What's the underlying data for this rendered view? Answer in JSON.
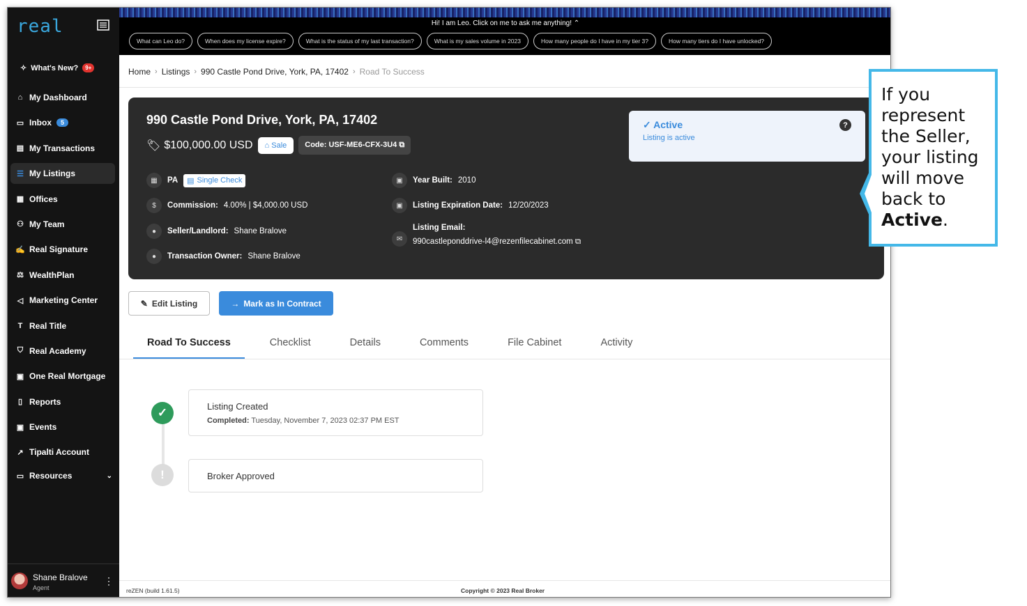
{
  "sidebar": {
    "logo": "real",
    "whats_new": "What's New?",
    "whats_new_badge": "9+",
    "items": [
      {
        "label": "My Dashboard"
      },
      {
        "label": "Inbox",
        "count": "5"
      },
      {
        "label": "My Transactions"
      },
      {
        "label": "My Listings"
      },
      {
        "label": "Offices"
      },
      {
        "label": "My Team"
      },
      {
        "label": "Real Signature"
      },
      {
        "label": "WealthPlan"
      },
      {
        "label": "Marketing Center"
      },
      {
        "label": "Real Title"
      },
      {
        "label": "Real Academy"
      },
      {
        "label": "One Real Mortgage"
      },
      {
        "label": "Reports"
      },
      {
        "label": "Events"
      },
      {
        "label": "Tipalti Account"
      },
      {
        "label": "Resources"
      }
    ],
    "user": {
      "name": "Shane Bralove",
      "role": "Agent"
    }
  },
  "banner": {
    "title": "Hi! I am Leo. Click on me to ask me anything!",
    "chips": [
      "What can Leo do?",
      "When does my license expire?",
      "What is the status of my last transaction?",
      "What is my sales volume in 2023",
      "How many people do I have in my tier 3?",
      "How many tiers do I have unlocked?"
    ]
  },
  "breadcrumb": [
    "Home",
    "Listings",
    "990 Castle Pond Drive, York, PA, 17402",
    "Road To Success"
  ],
  "listing": {
    "address": "990 Castle Pond Drive, York, PA, 17402",
    "price": "$100,000.00 USD",
    "sale_label": "Sale",
    "code": "Code: USF-ME6-CFX-3U4",
    "state": "PA",
    "single_check": "Single Check",
    "commission_label": "Commission:",
    "commission_value": "4.00% | $4,000.00 USD",
    "seller_label": "Seller/Landlord:",
    "seller_value": "Shane Bralove",
    "owner_label": "Transaction Owner:",
    "owner_value": "Shane Bralove",
    "year_label": "Year Built:",
    "year_value": "2010",
    "expiration_label": "Listing Expiration Date:",
    "expiration_value": "12/20/2023",
    "email_label": "Listing Email:",
    "email_value": "990castleponddrive-l4@rezenfilecabinet.com"
  },
  "status": {
    "title": "Active",
    "subtitle": "Listing is active"
  },
  "actions": {
    "edit": "Edit Listing",
    "contract": "Mark as In Contract"
  },
  "tabs": [
    "Road To Success",
    "Checklist",
    "Details",
    "Comments",
    "File Cabinet",
    "Activity"
  ],
  "steps": [
    {
      "title": "Listing Created",
      "sub_label": "Completed:",
      "sub_value": "Tuesday, November 7, 2023 02:37 PM EST"
    },
    {
      "title": "Broker Approved"
    }
  ],
  "footer": {
    "build": "reZEN (build 1.61.5)",
    "copyright": "Copyright © 2023 Real Broker"
  },
  "callout": {
    "text": "If you represent the Seller, your listing will move back to",
    "emphasis": "Active",
    "end": "."
  },
  "colors": {
    "accent": "#3a8bdc",
    "success": "#2e9b5b",
    "callout_border": "#44b8e8",
    "card": "#2b2b2b",
    "sidebar": "#141414"
  }
}
